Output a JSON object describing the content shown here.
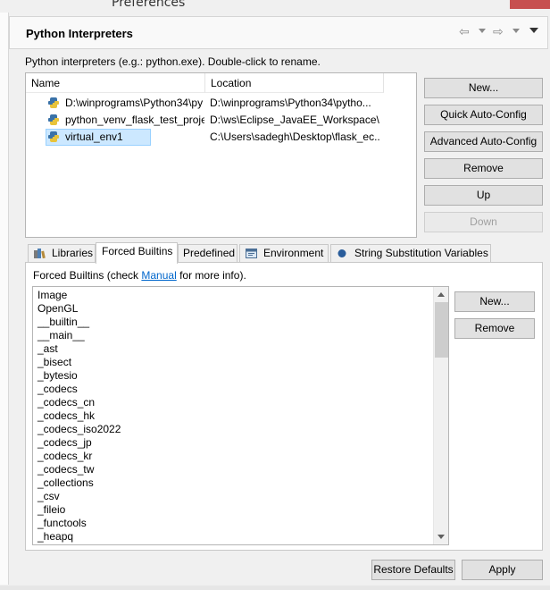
{
  "window": {
    "title": "Preferences"
  },
  "header": {
    "title": "Python Interpreters"
  },
  "interpreters": {
    "hint": "Python interpreters (e.g.: python.exe).   Double-click to rename.",
    "columns": [
      "Name",
      "Location"
    ],
    "rows": [
      {
        "name": "D:\\winprograms\\Python34\\py",
        "location": "D:\\winprograms\\Python34\\pytho..."
      },
      {
        "name": "python_venv_flask_test_projec",
        "location": "D:\\ws\\Eclipse_JavaEE_Workspace\\f..."
      },
      {
        "name": "virtual_env1",
        "location": "C:\\Users\\sadegh\\Desktop\\flask_ec..."
      }
    ],
    "selected_index": 2
  },
  "interpreter_buttons": {
    "new": "New...",
    "quick_auto_config": "Quick Auto-Config",
    "advanced_auto_config": "Advanced Auto-Config",
    "remove": "Remove",
    "up": "Up",
    "down": "Down"
  },
  "tabs": {
    "libraries": "Libraries",
    "forced_builtins": "Forced Builtins",
    "predefined": "Predefined",
    "environment": "Environment",
    "string_substitution": "String Substitution Variables"
  },
  "forced_builtins": {
    "info_prefix": "Forced Builtins (check ",
    "info_link": "Manual",
    "info_suffix": " for more info).",
    "items": [
      "Image",
      "OpenGL",
      "__builtin__",
      "__main__",
      "_ast",
      "_bisect",
      "_bytesio",
      "_codecs",
      "_codecs_cn",
      "_codecs_hk",
      "_codecs_iso2022",
      "_codecs_jp",
      "_codecs_kr",
      "_codecs_tw",
      "_collections",
      "_csv",
      "_fileio",
      "_functools",
      "_heapq"
    ],
    "buttons": {
      "new": "New...",
      "remove": "Remove"
    }
  },
  "footer": {
    "restore_defaults": "Restore Defaults",
    "apply": "Apply"
  },
  "icons": {
    "python": "python-icon",
    "libraries": "books-icon",
    "environment": "environment-icon",
    "string_substitution": "blue-dot-icon",
    "back": "back-arrow-icon",
    "forward": "forward-arrow-icon"
  },
  "colors": {
    "selection": "#cce8ff",
    "link": "#0066cc",
    "close_button": "#c75050"
  }
}
